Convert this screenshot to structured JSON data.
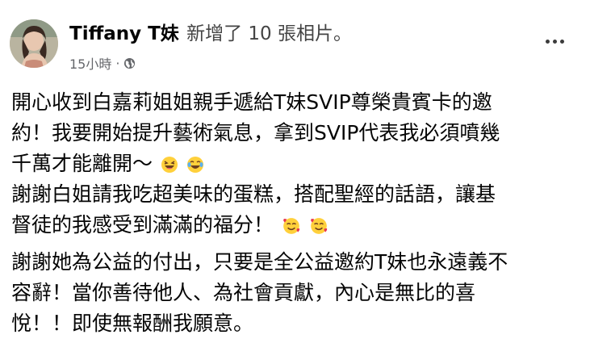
{
  "post": {
    "author_name": "Tiffany T妹",
    "action_text": "新增了 10 張相片。",
    "timestamp": "15小時",
    "separator": "·",
    "visibility_icon": "public-globe-icon",
    "more_icon": "more-horizontal-icon",
    "paragraph1_lines": [
      "開心收到白嘉莉姐姐親手遞給T妹SVIP尊榮貴賓卡的邀",
      "約！我要開始提升藝術氣息，拿到SVIP代表我必須噴幾",
      "千萬才能離開～",
      "謝謝白姐請我吃超美味的蛋糕，搭配聖經的話語，讓基",
      "督徒的我感受到滿滿的福分！"
    ],
    "paragraph2_lines": [
      "謝謝她為公益的付出，只要是全公益邀約T妹也永遠義不",
      "容辭！當你善待他人、為社會貢獻，內心是無比的喜",
      "悅！！即使無報酬我願意。"
    ],
    "emojis": [
      "laughing-emoji",
      "laughing-tears-emoji",
      "smiling-face-with-hearts-emoji",
      "smiling-face-with-hearts-emoji"
    ]
  }
}
